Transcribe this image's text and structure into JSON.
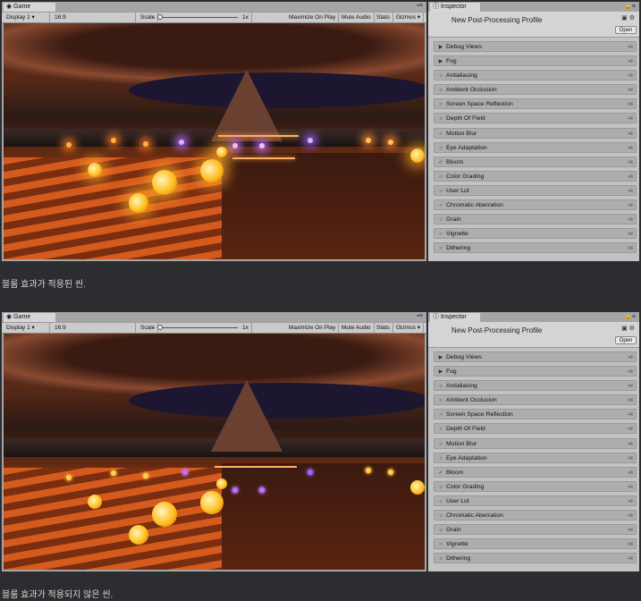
{
  "game": {
    "tab_label": "Game",
    "display": "Display 1",
    "aspect": "16:9",
    "scale_label": "Scale",
    "scale_value": "1x",
    "maximize_on_play": "Maximize On Play",
    "mute_audio": "Mute Audio",
    "stats": "Stats",
    "gizmos": "Gizmos"
  },
  "inspector": {
    "tab_label": "Inspector",
    "profile_name": "New Post-Processing Profile",
    "open_button": "Open",
    "effects": [
      {
        "label": "Debug Views",
        "state": "expand"
      },
      {
        "label": "Fog",
        "state": "expand"
      },
      {
        "label": "Antialiasing",
        "state": "off"
      },
      {
        "label": "Ambient Occlusion",
        "state": "off"
      },
      {
        "label": "Screen Space Reflection",
        "state": "off"
      },
      {
        "label": "Depth Of Field",
        "state": "off"
      },
      {
        "label": "Motion Blur",
        "state": "off"
      },
      {
        "label": "Eye Adaptation",
        "state": "off"
      },
      {
        "label": "Bloom",
        "state": "on"
      },
      {
        "label": "Color Grading",
        "state": "off"
      },
      {
        "label": "User Lut",
        "state": "off"
      },
      {
        "label": "Chromatic Aberration",
        "state": "off"
      },
      {
        "label": "Grain",
        "state": "off"
      },
      {
        "label": "Vignette",
        "state": "off"
      },
      {
        "label": "Dithering",
        "state": "off"
      }
    ]
  },
  "captions": {
    "with_bloom": "블룸 효과가 적용된 씬.",
    "without_bloom": "블룸 효과가 적용되지 않은 씬."
  },
  "colors": {
    "page_bg": "#2b2d31",
    "orb": "#ffc020",
    "light_purple": "#c070ff",
    "light_orange": "#ff8a30"
  }
}
